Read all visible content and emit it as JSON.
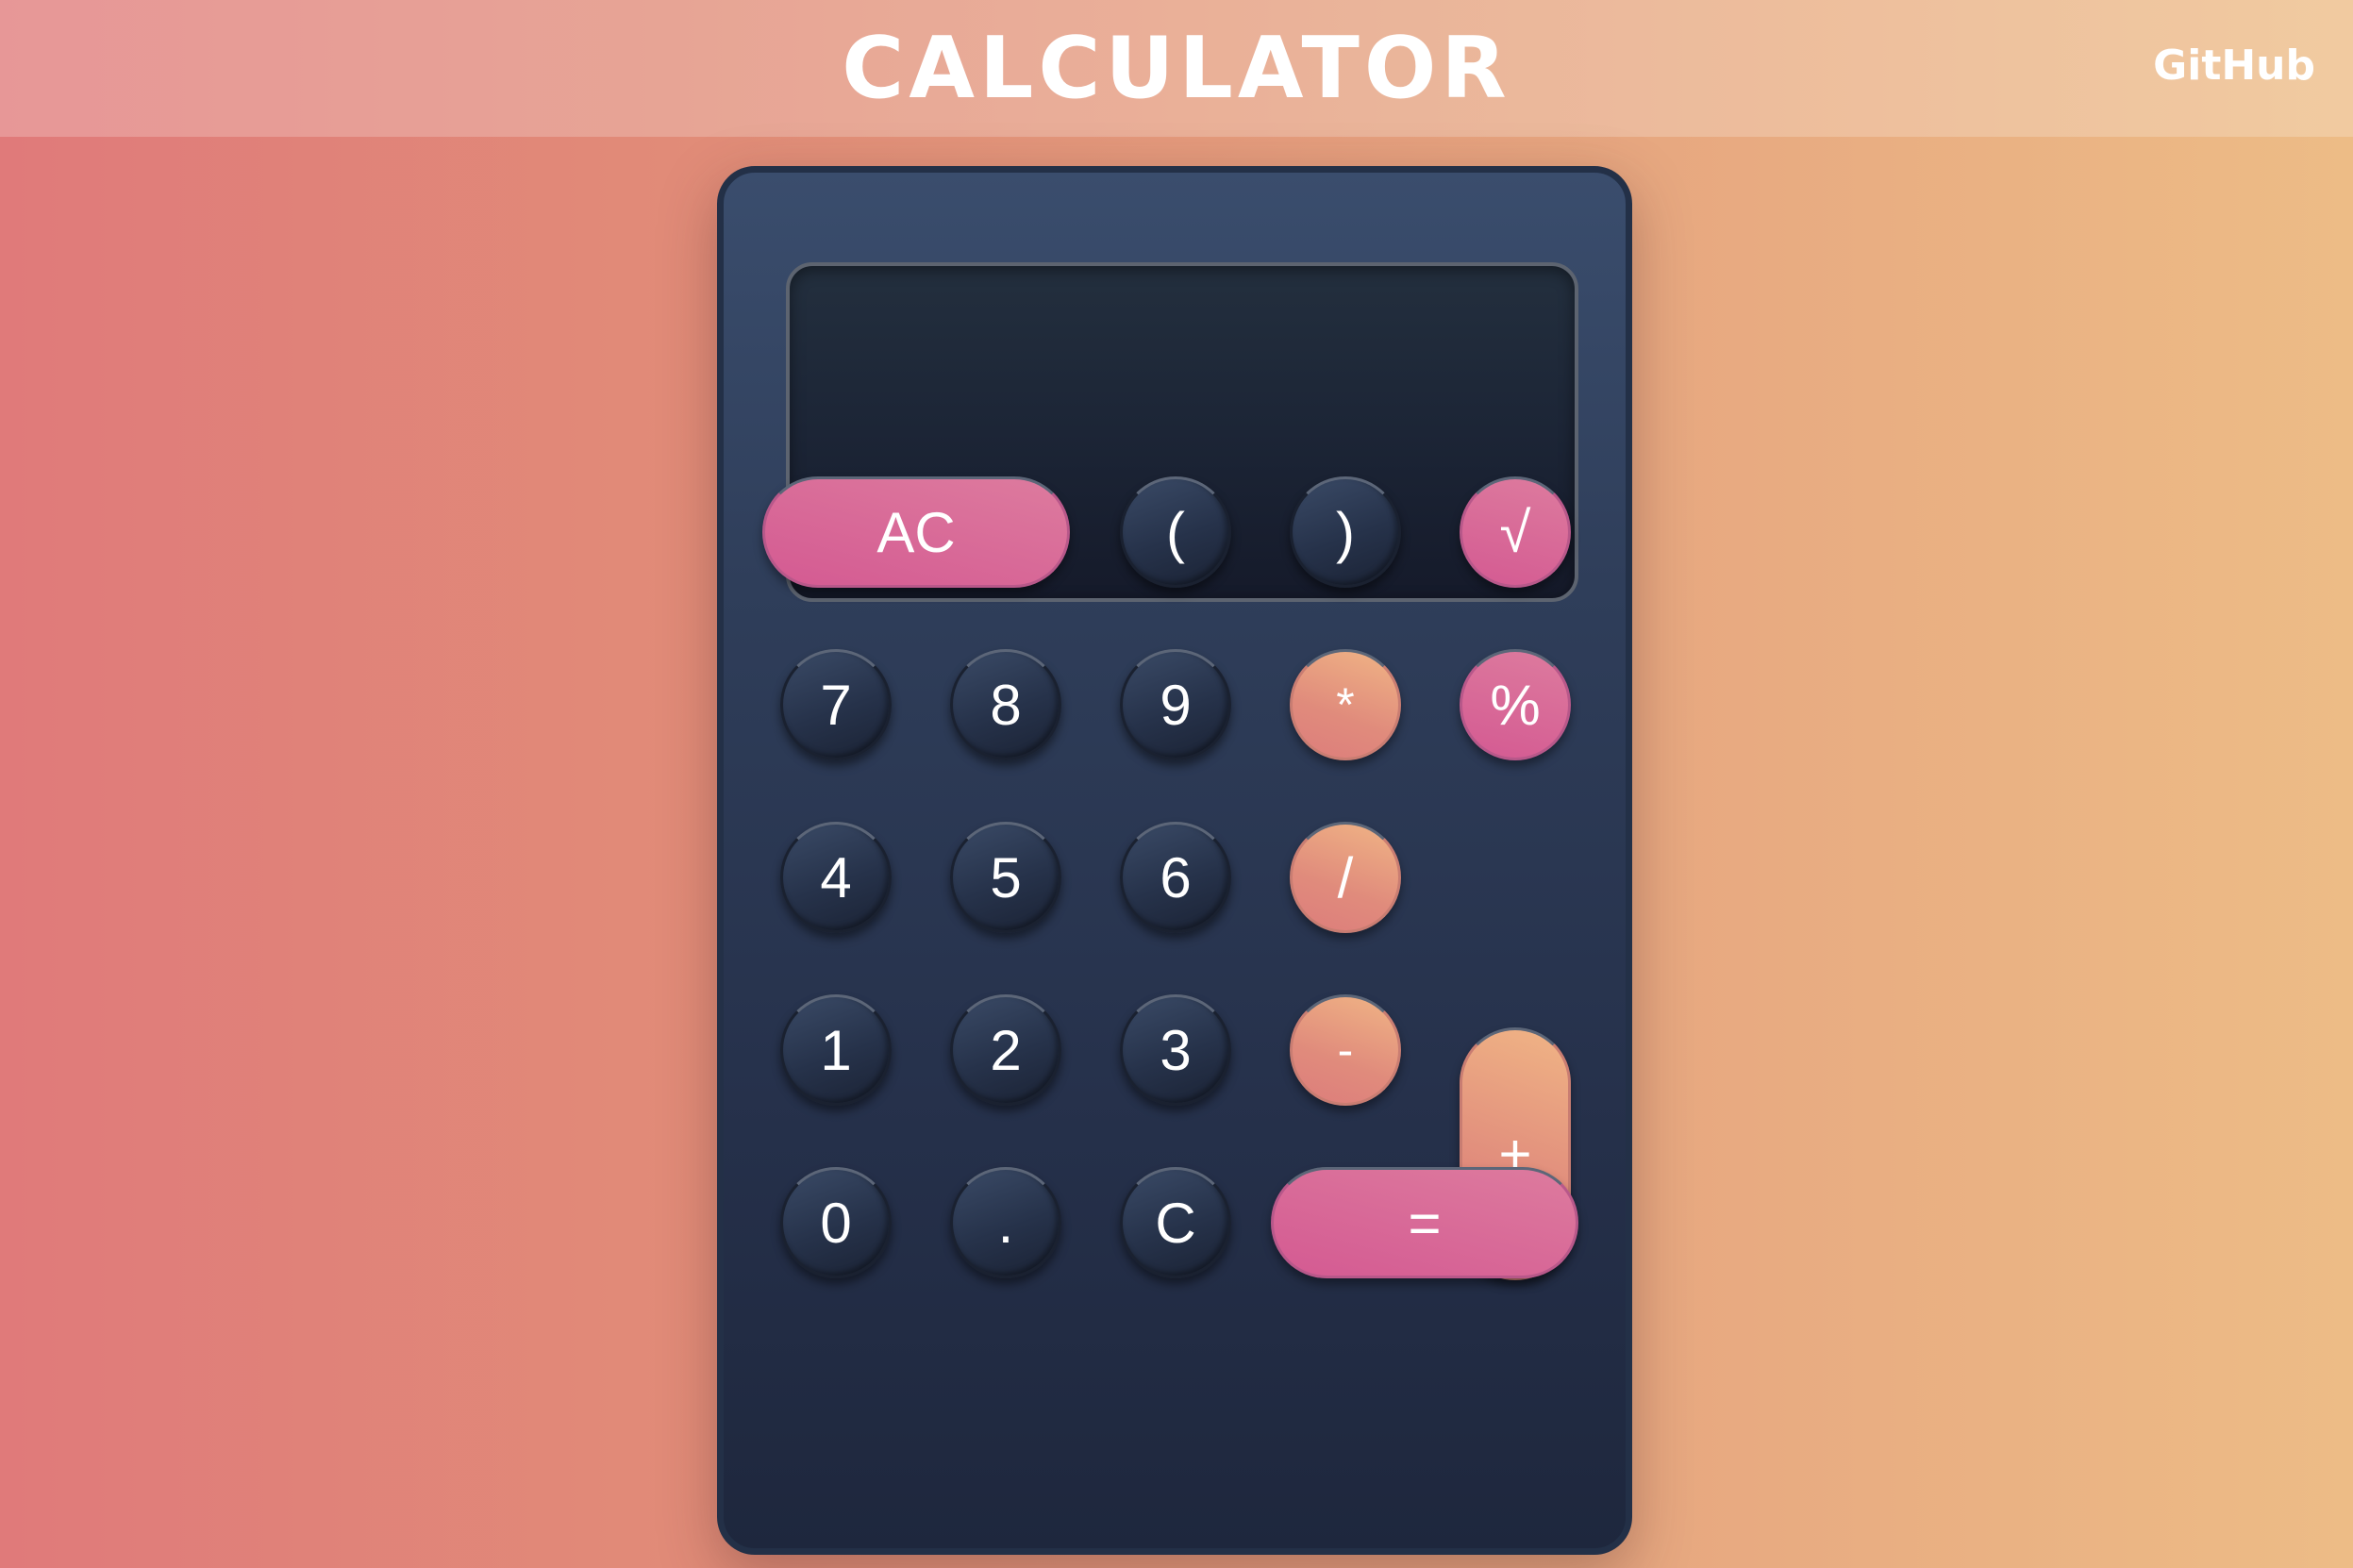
{
  "header": {
    "title": "CALCULATOR",
    "github_label": "GitHub"
  },
  "display": {
    "value": ""
  },
  "keys": {
    "ac": "AC",
    "open_paren": "(",
    "close_paren": ")",
    "sqrt": "√",
    "seven": "7",
    "eight": "8",
    "nine": "9",
    "multiply": "*",
    "percent": "%",
    "four": "4",
    "five": "5",
    "six": "6",
    "divide": "/",
    "plus": "+",
    "one": "1",
    "two": "2",
    "three": "3",
    "minus": "-",
    "zero": "0",
    "dot": ".",
    "clear": "C",
    "equals": "="
  },
  "colors": {
    "pink_key": "#d8649a",
    "orange_key": "#e89c80",
    "dark_key": "#2a3650",
    "calculator_body": "#2f3e5a"
  }
}
